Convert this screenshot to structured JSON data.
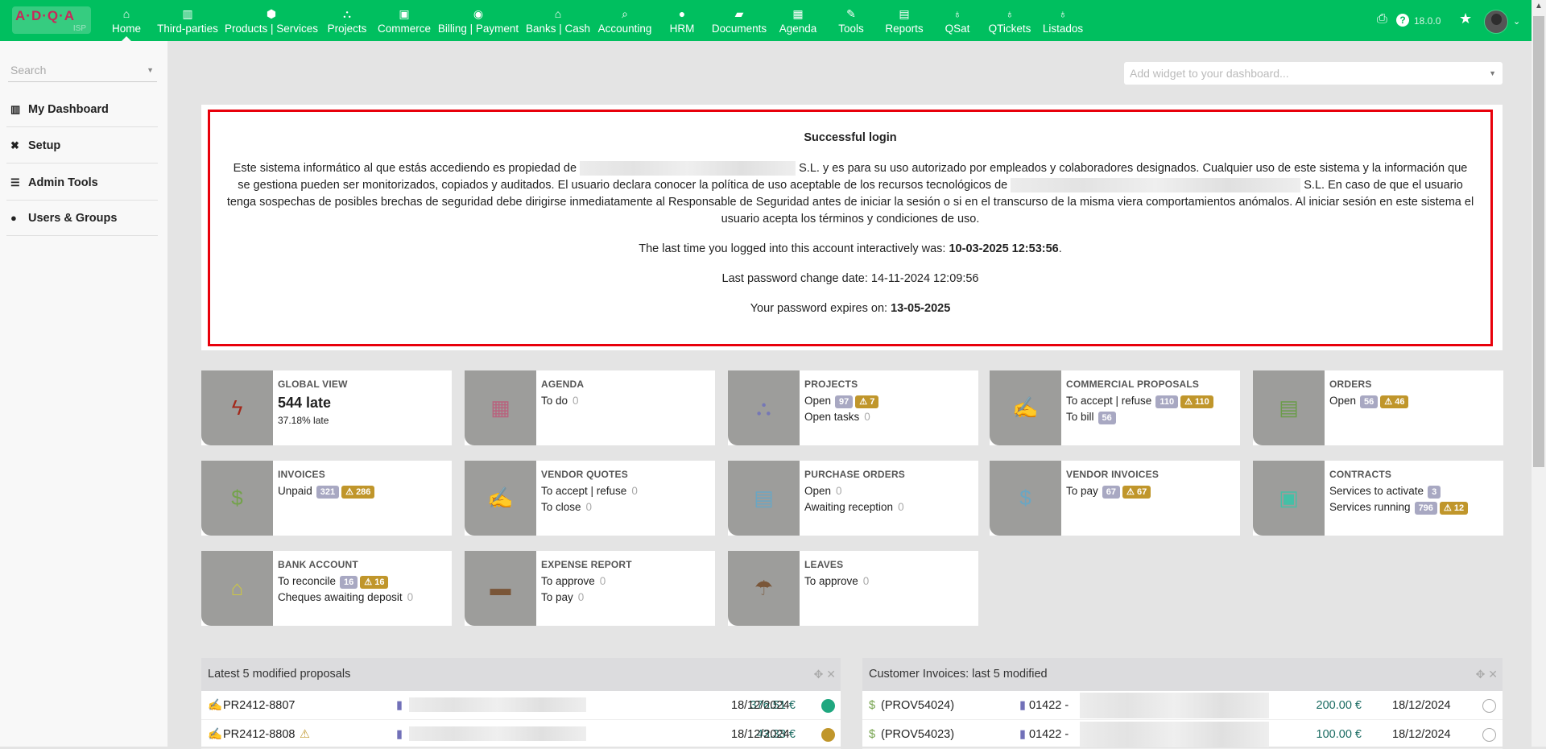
{
  "brand": {
    "logo_text": "A·D·Q·A",
    "logo_sub": "ISP"
  },
  "nav": [
    {
      "label": "Home",
      "icon": "home-icon",
      "glyph": "⌂"
    },
    {
      "label": "Third-parties",
      "icon": "building-icon",
      "glyph": "▥"
    },
    {
      "label": "Products | Services",
      "icon": "cube-icon",
      "glyph": "⬢"
    },
    {
      "label": "Projects",
      "icon": "project-diagram-icon",
      "glyph": "⛬"
    },
    {
      "label": "Commerce",
      "icon": "briefcase-icon",
      "glyph": "▣"
    },
    {
      "label": "Billing | Payment",
      "icon": "coins-icon",
      "glyph": "◉"
    },
    {
      "label": "Banks | Cash",
      "icon": "bank-icon",
      "glyph": "⌂"
    },
    {
      "label": "Accounting",
      "icon": "search-dollar-icon",
      "glyph": "⌕"
    },
    {
      "label": "HRM",
      "icon": "user-tie-icon",
      "glyph": "●"
    },
    {
      "label": "Documents",
      "icon": "folder-open-icon",
      "glyph": "▰"
    },
    {
      "label": "Agenda",
      "icon": "calendar-icon",
      "glyph": "▦"
    },
    {
      "label": "Tools",
      "icon": "wrench-icon",
      "glyph": "✎"
    },
    {
      "label": "Reports",
      "icon": "reports-icon",
      "glyph": "▤"
    },
    {
      "label": "QSat",
      "icon": "qsat-icon",
      "glyph": "♁"
    },
    {
      "label": "QTickets",
      "icon": "qtickets-icon",
      "glyph": "♁"
    },
    {
      "label": "Listados",
      "icon": "listados-icon",
      "glyph": "♁"
    }
  ],
  "topright": {
    "version": "18.0.0"
  },
  "sidebar": {
    "search_placeholder": "Search",
    "items": [
      {
        "label": "My Dashboard",
        "icon": "chart-bar-icon",
        "glyph": "▥"
      },
      {
        "label": "Setup",
        "icon": "tools-icon",
        "glyph": "✖"
      },
      {
        "label": "Admin Tools",
        "icon": "server-icon",
        "glyph": "☰"
      },
      {
        "label": "Users & Groups",
        "icon": "user-icon",
        "glyph": "●"
      }
    ]
  },
  "add_widget_placeholder": "Add widget to your dashboard...",
  "login": {
    "title": "Successful login",
    "p1a": "Este sistema informático al que estás accediendo es propiedad de",
    "p1b": "S.L. y es para su uso autorizado por empleados y colaboradores designados. Cualquier uso de este sistema y la información que se gestiona pueden ser monitorizados, copiados y auditados. El usuario declara conocer la política de uso aceptable de los recursos tecnológicos de",
    "p1c": "S.L. En caso de que el usuario tenga sospechas de posibles brechas de seguridad debe dirigirse inmediatamente al Responsable de Seguridad antes de iniciar la sesión o si en el transcurso de la misma viera comportamientos anómalos. Al iniciar sesión en este sistema el usuario acepta los términos y condiciones de uso.",
    "last_login_label": "The last time you logged into this account interactively was:",
    "last_login_value": "10-03-2025 12:53:56",
    "pwd_change": "Last password change date: 14-11-2024 12:09:56",
    "pwd_expire_label": "Your password expires on:",
    "pwd_expire_value": "13-05-2025"
  },
  "widgets": [
    {
      "title": "GLOBAL VIEW",
      "icon": "bolt-icon",
      "glyph": "ϟ",
      "color": "#a3281a",
      "big": "544 late",
      "small": "37.18% late",
      "lines": []
    },
    {
      "title": "AGENDA",
      "icon": "calendar-icon",
      "glyph": "▦",
      "color": "#b8637e",
      "lines": [
        {
          "label": "To do",
          "value": "0"
        }
      ]
    },
    {
      "title": "PROJECTS",
      "icon": "project-diagram-icon",
      "glyph": "⛬",
      "color": "#7577b6",
      "lines": [
        {
          "label": "Open",
          "badges": [
            {
              "text": "97"
            },
            {
              "text": "7",
              "warn": true
            }
          ]
        },
        {
          "label": "Open tasks",
          "value": "0"
        }
      ]
    },
    {
      "title": "COMMERCIAL PROPOSALS",
      "icon": "file-signature-icon",
      "glyph": "✍",
      "color": "#6b9c4a",
      "lines": [
        {
          "label": "To accept | refuse",
          "badges": [
            {
              "text": "110"
            },
            {
              "text": "110",
              "warn": true
            }
          ]
        },
        {
          "label": "To bill",
          "badges": [
            {
              "text": "56"
            }
          ]
        }
      ]
    },
    {
      "title": "ORDERS",
      "icon": "file-invoice-icon",
      "glyph": "▤",
      "color": "#6b9c4a",
      "lines": [
        {
          "label": "Open",
          "badges": [
            {
              "text": "56"
            },
            {
              "text": "46",
              "warn": true
            }
          ]
        }
      ]
    },
    {
      "title": "INVOICES",
      "icon": "file-invoice-dollar-icon",
      "glyph": "$",
      "color": "#74a24c",
      "lines": [
        {
          "label": "Unpaid",
          "badges": [
            {
              "text": "321"
            },
            {
              "text": "286",
              "warn": true
            }
          ]
        }
      ]
    },
    {
      "title": "VENDOR QUOTES",
      "icon": "file-signature-icon",
      "glyph": "✍",
      "color": "#6aa6c3",
      "lines": [
        {
          "label": "To accept | refuse",
          "value": "0"
        },
        {
          "label": "To close",
          "value": "0"
        }
      ]
    },
    {
      "title": "PURCHASE ORDERS",
      "icon": "file-invoice-icon",
      "glyph": "▤",
      "color": "#6aa6c3",
      "lines": [
        {
          "label": "Open",
          "value": "0"
        },
        {
          "label": "Awaiting reception",
          "value": "0"
        }
      ]
    },
    {
      "title": "VENDOR INVOICES",
      "icon": "file-invoice-dollar-icon",
      "glyph": "$",
      "color": "#6aa6c3",
      "lines": [
        {
          "label": "To pay",
          "badges": [
            {
              "text": "67"
            },
            {
              "text": "67",
              "warn": true
            }
          ]
        }
      ]
    },
    {
      "title": "CONTRACTS",
      "icon": "suitcase-icon",
      "glyph": "▣",
      "color": "#45bfa6",
      "lines": [
        {
          "label": "Services to activate",
          "badges": [
            {
              "text": "3"
            }
          ]
        },
        {
          "label": "Services running",
          "badges": [
            {
              "text": "796"
            },
            {
              "text": "12",
              "warn": true
            }
          ]
        }
      ]
    },
    {
      "title": "BANK ACCOUNT",
      "icon": "bank-icon",
      "glyph": "⌂",
      "color": "#cdc742",
      "lines": [
        {
          "label": "To reconcile",
          "badges": [
            {
              "text": "16"
            },
            {
              "text": "16",
              "warn": true
            }
          ]
        },
        {
          "label": "Cheques awaiting deposit",
          "value": "0"
        }
      ]
    },
    {
      "title": "EXPENSE REPORT",
      "icon": "wallet-icon",
      "glyph": "▬",
      "color": "#7a5638",
      "lines": [
        {
          "label": "To approve",
          "value": "0"
        },
        {
          "label": "To pay",
          "value": "0"
        }
      ]
    },
    {
      "title": "LEAVES",
      "icon": "umbrella-beach-icon",
      "glyph": "☂",
      "color": "#7a5638",
      "lines": [
        {
          "label": "To approve",
          "value": "0"
        }
      ]
    }
  ],
  "proposals": {
    "title": "Latest 5 modified proposals",
    "rows": [
      {
        "ref": "PR2412-8807",
        "warn": false,
        "amount": "376.51 €",
        "date": "18/12/2024",
        "status_color": "#1fa77f"
      },
      {
        "ref": "PR2412-8808",
        "warn": true,
        "amount": "43.33 €",
        "date": "18/12/2024",
        "status_color": "#c0962b"
      }
    ]
  },
  "invoices": {
    "title": "Customer Invoices: last 5 modified",
    "rows": [
      {
        "ref": "(PROV54024)",
        "third": "01422 -",
        "amount": "200.00 €",
        "date": "18/12/2024"
      },
      {
        "ref": "(PROV54023)",
        "third": "01422 -",
        "amount": "100.00 €",
        "date": "18/12/2024"
      }
    ]
  }
}
